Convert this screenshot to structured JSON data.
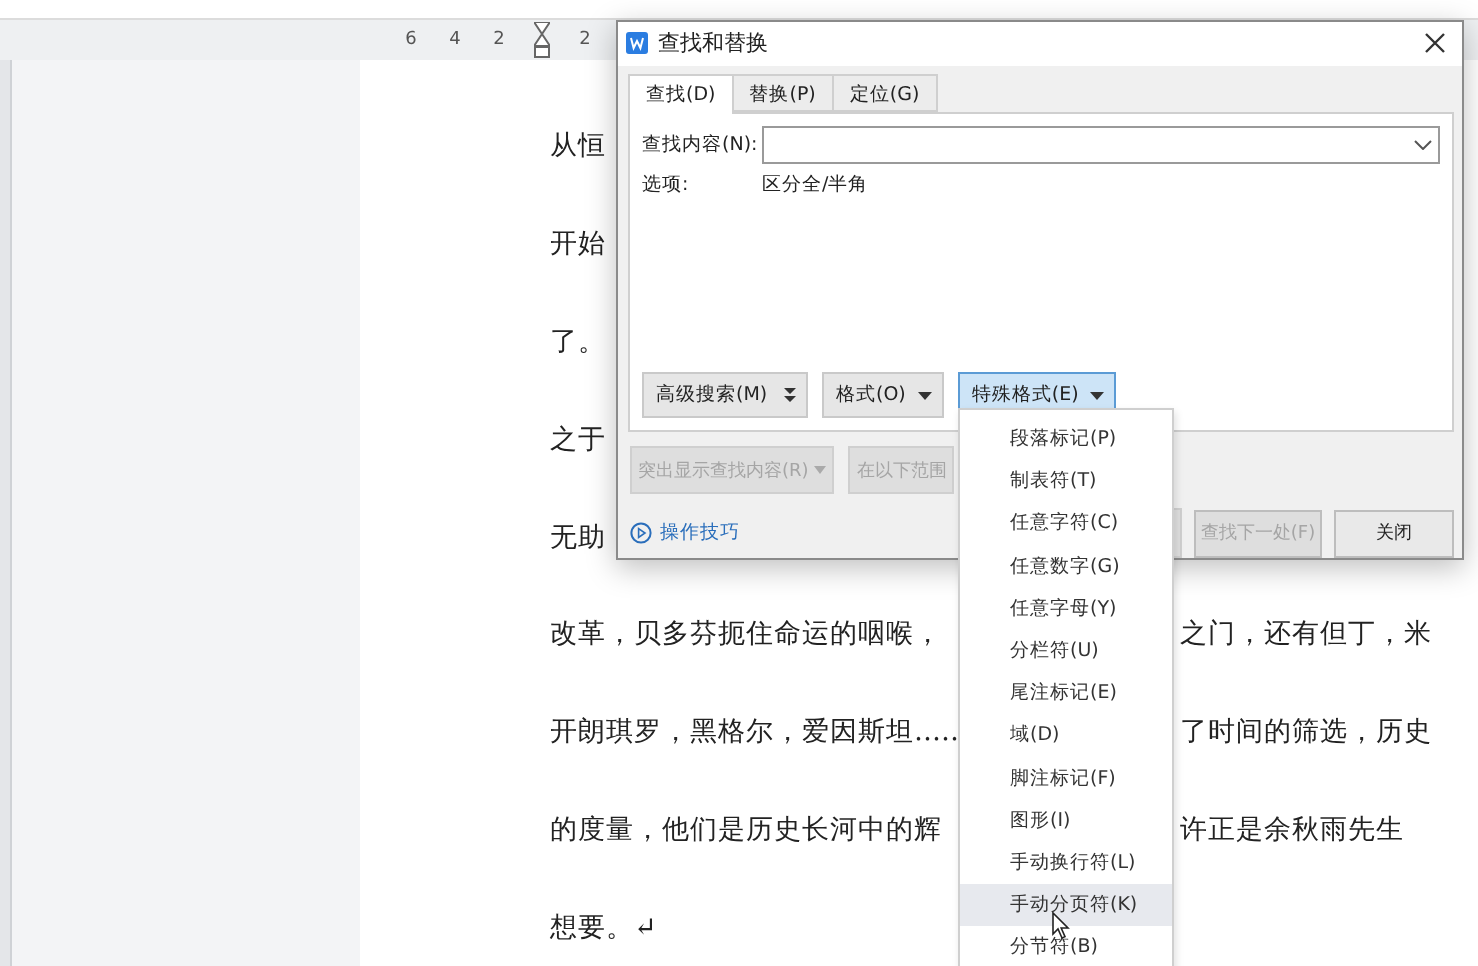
{
  "ruler": {
    "ticks": [
      "6",
      "4",
      "2",
      "2"
    ]
  },
  "document": {
    "lines": [
      {
        "left": "从恒"
      },
      {
        "left": "开始"
      },
      {
        "left": "了。"
      },
      {
        "left": "之于"
      },
      {
        "left": "无助"
      },
      {
        "left": "改革，贝多芬扼住命运的咽喉，",
        "right": "之门，还有但丁，米"
      },
      {
        "left": "开朗琪罗，黑格尔，爱因斯坦……",
        "right": "了时间的筛选，历史"
      },
      {
        "left": "的度量，他们是历史长河中的辉",
        "right": "许正是余秋雨先生"
      },
      {
        "left": "想要。↵"
      }
    ]
  },
  "dialog": {
    "title": "查找和替换",
    "tabs": [
      {
        "label": "查找(D)",
        "selected": true
      },
      {
        "label": "替换(P)",
        "selected": false
      },
      {
        "label": "定位(G)",
        "selected": false
      }
    ],
    "find_field": {
      "label": "查找内容(N):"
    },
    "options": {
      "label": "选项:",
      "value": "区分全/半角"
    },
    "format_buttons": [
      {
        "label": "高级搜索(M)",
        "kind": "expand",
        "open": false
      },
      {
        "label": "格式(O)",
        "kind": "dropdown",
        "open": false
      },
      {
        "label": "特殊格式(E)",
        "kind": "dropdown",
        "open": true
      }
    ],
    "scope_buttons": [
      {
        "label": "突出显示查找内容(R)",
        "disabled": true
      },
      {
        "label": "在以下范围",
        "disabled": true
      }
    ],
    "tips_link": "操作技巧",
    "footer_buttons": [
      {
        "label": "查找下一处(F)",
        "disabled": true
      },
      {
        "label": "关闭",
        "disabled": false
      }
    ]
  },
  "special_menu": {
    "items": [
      {
        "label": "段落标记(P)",
        "hovered": false
      },
      {
        "label": "制表符(T)",
        "hovered": false
      },
      {
        "label": "任意字符(C)",
        "hovered": false
      },
      {
        "label": "任意数字(G)",
        "hovered": false
      },
      {
        "label": "任意字母(Y)",
        "hovered": false
      },
      {
        "label": "分栏符(U)",
        "hovered": false
      },
      {
        "label": "尾注标记(E)",
        "hovered": false
      },
      {
        "label": "域(D)",
        "hovered": false
      },
      {
        "label": "脚注标记(F)",
        "hovered": false
      },
      {
        "label": "图形(I)",
        "hovered": false
      },
      {
        "label": "手动换行符(L)",
        "hovered": false
      },
      {
        "label": "手动分页符(K)",
        "hovered": true
      },
      {
        "label": "分节符(B)",
        "hovered": false
      }
    ]
  }
}
